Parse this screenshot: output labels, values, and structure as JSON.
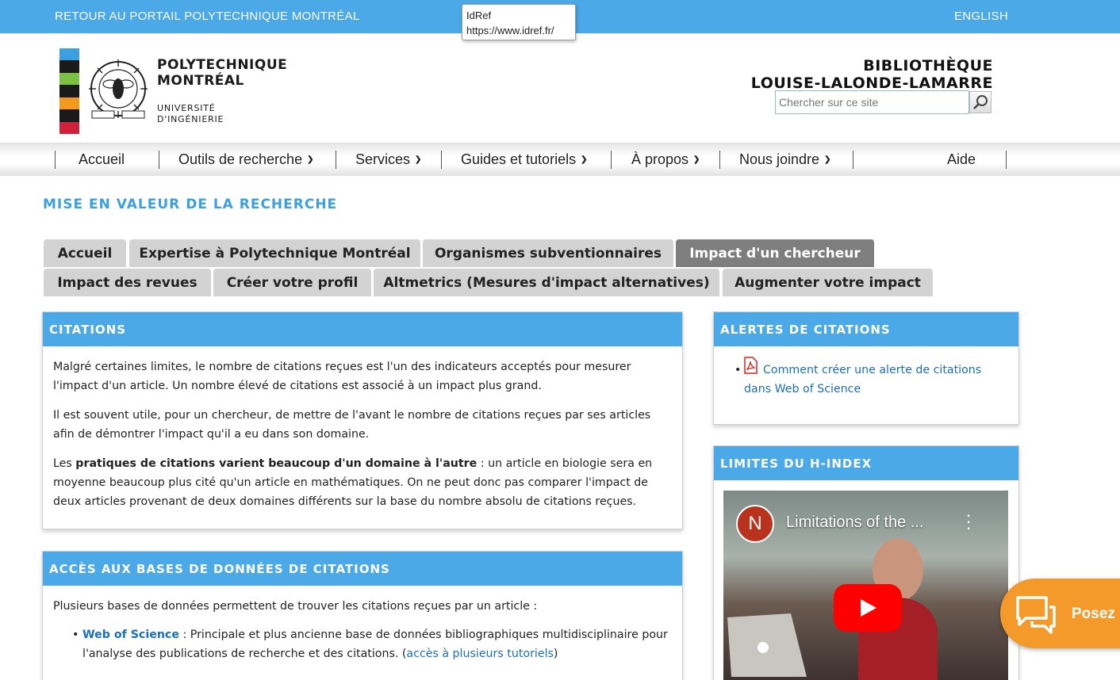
{
  "topbar": {
    "portal_link": "RETOUR AU PORTAIL POLYTECHNIQUE MONTRÉAL",
    "language_link": "ENGLISH"
  },
  "tooltip": {
    "line1": "IdRef",
    "line2": "https://www.idref.fr/"
  },
  "header": {
    "poly_line1": "POLYTECHNIQUE",
    "poly_line2": "MONTRÉAL",
    "poly_sub1": "UNIVERSITÉ",
    "poly_sub2": "D'INGÉNIERIE",
    "library_line1": "BIBLIOTHÈQUE",
    "library_line2": "LOUISE-LALONDE-LAMARRE",
    "search_placeholder": "Chercher sur ce site",
    "logo_colors": [
      "#3aa0e0",
      "#1a1a1a",
      "#7ac142",
      "#1a1a1a",
      "#f39a1e",
      "#1a1a1a",
      "#d0203a"
    ]
  },
  "nav": {
    "items": [
      {
        "label": "Accueil"
      },
      {
        "label": "Outils de recherche"
      },
      {
        "label": "Services"
      },
      {
        "label": "Guides et tutoriels"
      },
      {
        "label": "À propos"
      },
      {
        "label": "Nous joindre"
      },
      {
        "label": "Aide"
      }
    ]
  },
  "page": {
    "title": "MISE EN VALEUR DE LA RECHERCHE",
    "tabs_row1": [
      "Accueil",
      "Expertise à Polytechnique Montréal",
      "Organismes subventionnaires",
      "Impact d'un chercheur"
    ],
    "tabs_row2": [
      "Impact des revues",
      "Créer votre profil",
      "Altmetrics (Mesures d'impact alternatives)",
      "Augmenter votre impact"
    ],
    "active_tab": "Impact d'un chercheur"
  },
  "citations": {
    "heading": "CITATIONS",
    "p1": "Malgré certaines limites, le nombre de citations reçues est l'un des indicateurs acceptés pour mesurer l'impact d'un article. Un nombre élevé de citations est associé à un impact plus grand.",
    "p2": "Il est souvent utile, pour un chercheur, de mettre de l'avant le nombre de citations reçues par ses articles afin de démontrer l'impact qu'il a eu dans son domaine.",
    "p3_pre": "Les ",
    "p3_bold": "pratiques de citations varient beaucoup d'un domaine à l'autre",
    "p3_post": " : un article en biologie sera en moyenne beaucoup plus cité qu'un article en mathématiques. On ne peut donc pas comparer l'impact de deux articles provenant de deux domaines différents sur la base du nombre absolu de citations reçues."
  },
  "databases": {
    "heading": "ACCÈS AUX BASES DE DONNÉES DE CITATIONS",
    "intro": "Plusieurs bases de données permettent de trouver les citations reçues par un article :",
    "wos_link": "Web of Science",
    "wos_desc": " : Principale et plus ancienne base de données bibliographiques multidisciplinaire pour l'analyse des publications de recherche et des citations. (",
    "wos_tutorials": "accès à plusieurs tutoriels",
    "wos_close": ")"
  },
  "alerts": {
    "heading": "ALERTES DE CITATIONS",
    "link": "Comment créer une alerte de citations dans Web of Science"
  },
  "hindex": {
    "heading": "LIMITES DU H-INDEX",
    "video_title": "Limitations of the ...",
    "video_avatar": "N"
  },
  "chat": {
    "label": "Posez"
  }
}
